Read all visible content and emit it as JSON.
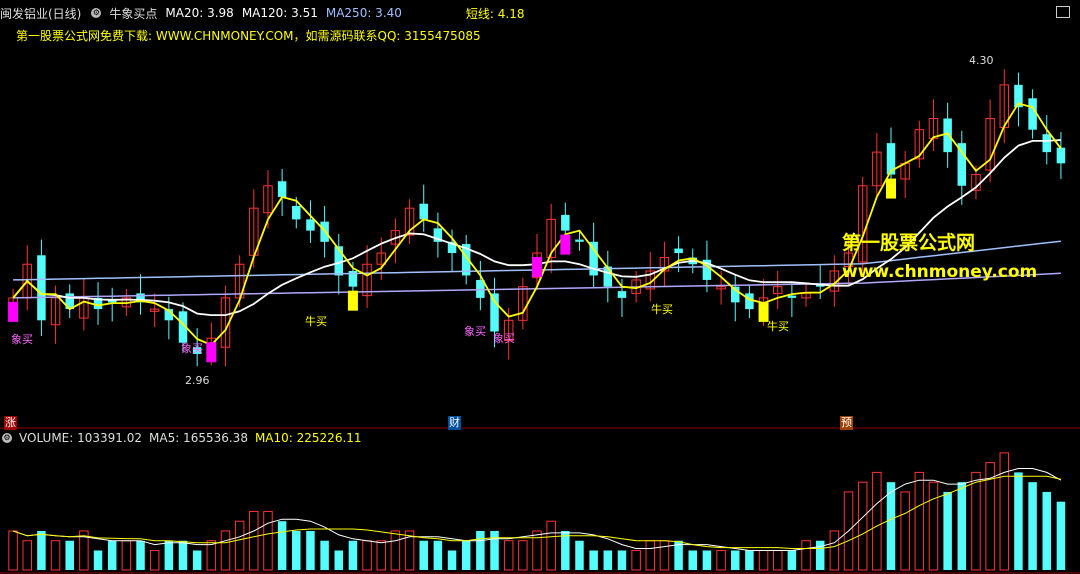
{
  "header": {
    "stock": "闽发铝业(日线)",
    "indicator": "牛象买点",
    "ma20": "MA20: 3.98",
    "ma120": "MA120: 3.51",
    "ma250": "MA250: 3.40",
    "short": "短线: 4.18",
    "subtitle": "第一股票公式网免费下载: WWW.CHNMONEY.COM，如需源码联系QQ: 3155475085"
  },
  "volume_header": {
    "volume": "VOLUME: 103391.02",
    "ma5": "MA5: 165536.38",
    "ma10": "MA10: 225226.11"
  },
  "annotations": {
    "high": "4.30",
    "low": "2.96",
    "xiang": "象买",
    "niu": "牛买"
  },
  "bottom_tags": {
    "zhang": "涨",
    "cai": "财",
    "yu": "预"
  },
  "watermark": {
    "line1": "第一股票公式网",
    "line2": "www.chnmoney.com"
  },
  "colors": {
    "up": "#ff3232",
    "down": "#54fcfc",
    "yellow": "#ffff00",
    "white": "#ffffff",
    "ma120": "#a0c0ff",
    "ma250": "#b0a8ff",
    "magenta": "#ff00ff"
  },
  "chart_data": [
    {
      "type": "candlestick",
      "title": "",
      "ylim": [
        2.8,
        4.45
      ],
      "close": [
        3.3,
        3.45,
        3.2,
        3.3,
        3.25,
        3.3,
        3.25,
        3.28,
        3.3,
        3.28,
        3.25,
        3.2,
        3.1,
        3.05,
        3.12,
        3.3,
        3.45,
        3.7,
        3.8,
        3.75,
        3.65,
        3.6,
        3.55,
        3.4,
        3.35,
        3.45,
        3.5,
        3.6,
        3.7,
        3.65,
        3.55,
        3.5,
        3.4,
        3.3,
        3.15,
        3.2,
        3.35,
        3.5,
        3.65,
        3.6,
        3.55,
        3.4,
        3.35,
        3.3,
        3.38,
        3.42,
        3.48,
        3.5,
        3.45,
        3.38,
        3.35,
        3.28,
        3.25,
        3.3,
        3.35,
        3.3,
        3.32,
        3.35,
        3.42,
        3.5,
        3.8,
        3.95,
        3.85,
        3.9,
        4.05,
        4.1,
        3.95,
        3.8,
        3.85,
        4.1,
        4.25,
        4.15,
        4.05,
        3.95,
        3.9
      ]
    },
    {
      "type": "line",
      "series": [
        {
          "name": "MA20"
        },
        {
          "name": "MA120"
        },
        {
          "name": "MA250"
        },
        {
          "name": "短线"
        }
      ]
    },
    {
      "type": "bar",
      "ylabel": "VOLUME",
      "values": [
        4,
        3,
        4,
        3,
        3,
        4,
        2,
        3,
        3,
        3,
        2,
        3,
        3,
        2,
        3,
        4,
        5,
        6,
        6,
        5,
        4,
        4,
        3,
        2,
        3,
        3,
        3,
        4,
        4,
        3,
        3,
        2,
        3,
        4,
        4,
        3,
        3,
        4,
        5,
        4,
        3,
        2,
        2,
        2,
        2,
        3,
        3,
        3,
        2,
        2,
        2,
        2,
        2,
        2,
        2,
        2,
        3,
        3,
        4,
        8,
        9,
        10,
        9,
        8,
        10,
        9,
        8,
        9,
        10,
        11,
        12,
        10,
        9,
        8,
        7
      ],
      "series": [
        {
          "name": "MA5"
        },
        {
          "name": "MA10"
        }
      ]
    }
  ]
}
